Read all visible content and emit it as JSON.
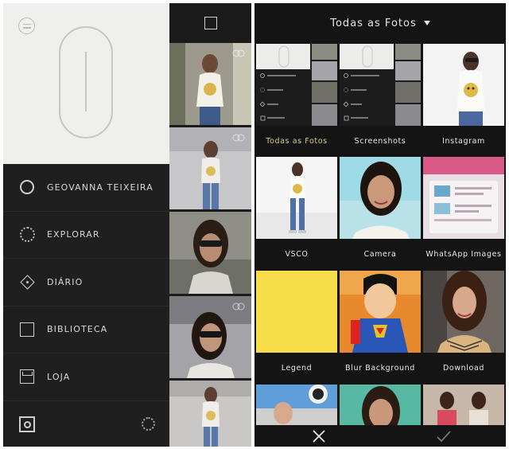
{
  "left_screen": {
    "drawer_items": [
      {
        "label": "GEOVANNA TEIXEIRA",
        "icon": "profile-circle-icon"
      },
      {
        "label": "EXPLORAR",
        "icon": "explore-dotted-circle-icon"
      },
      {
        "label": "DIÁRIO",
        "icon": "journal-diamond-icon"
      },
      {
        "label": "BIBLIOTECA",
        "icon": "library-square-icon"
      },
      {
        "label": "LOJA",
        "icon": "shop-box-icon"
      }
    ]
  },
  "right_screen": {
    "header_title": "Todas as Fotos",
    "albums": [
      {
        "label": "Todas as Fotos",
        "selected": true
      },
      {
        "label": "Screenshots",
        "selected": false
      },
      {
        "label": "Instagram",
        "selected": false
      },
      {
        "label": "VSCO",
        "selected": false
      },
      {
        "label": "Camera",
        "selected": false
      },
      {
        "label": "WhatsApp Images",
        "selected": false
      },
      {
        "label": "Legend",
        "selected": false
      },
      {
        "label": "Blur Background",
        "selected": false
      },
      {
        "label": "Download",
        "selected": false
      }
    ]
  },
  "colors": {
    "selected_label": "#d8c98d",
    "drawer_background": "#1f1f1f",
    "profile_background": "#efefed",
    "legend_thumb_yellow": "#f7dd4a"
  }
}
